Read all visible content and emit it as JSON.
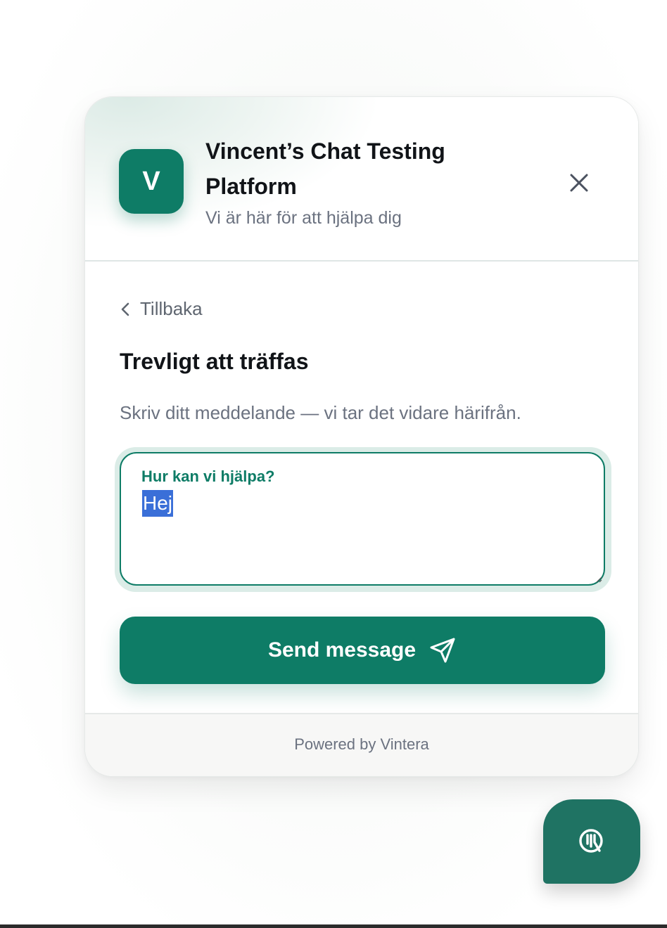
{
  "header": {
    "avatar_letter": "V",
    "title": "Vincent’s Chat Testing Platform",
    "subtitle": "Vi är här för att hjälpa dig",
    "close_icon": "close-icon"
  },
  "body": {
    "back_label": "Tillbaka",
    "heading": "Trevligt att träffas",
    "description": "Skriv ditt meddelande — vi tar det vidare härifrån.",
    "message_field": {
      "label": "Hur kan vi hjälpa?",
      "value": "Hej"
    },
    "send_button": {
      "label": "Send message",
      "icon": "send-icon"
    }
  },
  "footer": {
    "powered_by": "Powered by Vintera"
  },
  "launcher": {
    "icon": "chat-launcher-icon"
  },
  "colors": {
    "accent": "#0e7c66",
    "launcher": "#1f7363",
    "selection": "#3a6fd8"
  }
}
